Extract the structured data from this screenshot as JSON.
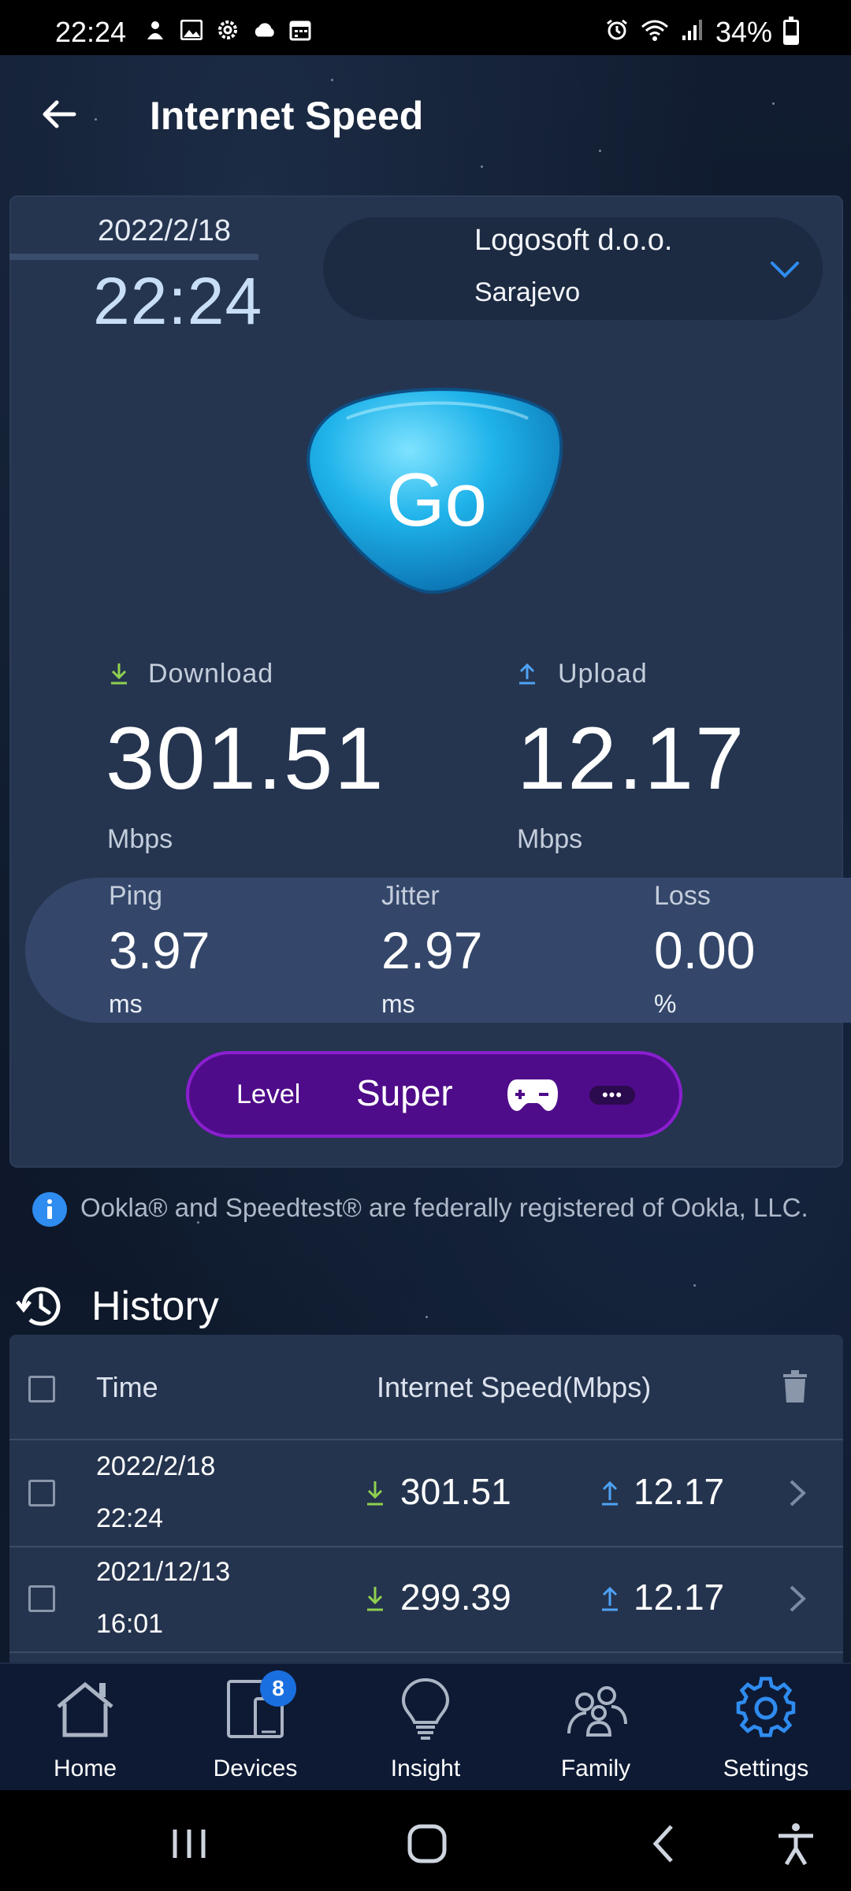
{
  "status_bar": {
    "time": "22:24",
    "battery": "34%",
    "left_icons": [
      "notification-icon",
      "gallery-icon",
      "settings-icon",
      "cloud-icon",
      "calendar-icon"
    ],
    "right_icons": [
      "alarm-icon",
      "wifi-icon",
      "signal-icon",
      "battery-icon"
    ]
  },
  "header": {
    "title": "Internet Speed"
  },
  "test": {
    "date": "2022/2/18",
    "time": "22:24",
    "server_name": "Logosoft d.o.o.",
    "server_city": "Sarajevo",
    "go_label": "Go"
  },
  "download": {
    "label": "Download",
    "value": "301.51",
    "unit": "Mbps"
  },
  "upload": {
    "label": "Upload",
    "value": "12.17",
    "unit": "Mbps"
  },
  "stats": [
    {
      "label": "Ping",
      "value": "3.97",
      "unit": "ms"
    },
    {
      "label": "Jitter",
      "value": "2.97",
      "unit": "ms"
    },
    {
      "label": "Loss",
      "value": "0.00",
      "unit": "%"
    }
  ],
  "level": {
    "label": "Level",
    "value": "Super",
    "more": "•••"
  },
  "info_text": "Ookla® and Speedtest® are federally registered of Ookla, LLC.",
  "history": {
    "title": "History",
    "columns": {
      "time": "Time",
      "speed": "Internet Speed(Mbps)"
    },
    "rows": [
      {
        "date": "2022/2/18",
        "time": "22:24",
        "download": "301.51",
        "upload": "12.17"
      },
      {
        "date": "2021/12/13",
        "time": "16:01",
        "download": "299.39",
        "upload": "12.17"
      }
    ]
  },
  "nav": [
    {
      "label": "Home",
      "icon": "home-icon"
    },
    {
      "label": "Devices",
      "icon": "devices-icon",
      "badge": "8"
    },
    {
      "label": "Insight",
      "icon": "lightbulb-icon"
    },
    {
      "label": "Family",
      "icon": "family-icon"
    },
    {
      "label": "Settings",
      "icon": "gear-icon",
      "active": true
    }
  ],
  "colors": {
    "accent": "#2f8cf0",
    "download_arrow": "#8fd14f",
    "upload_arrow": "#4ea3f5",
    "level_purple": "#4f0c8a"
  }
}
